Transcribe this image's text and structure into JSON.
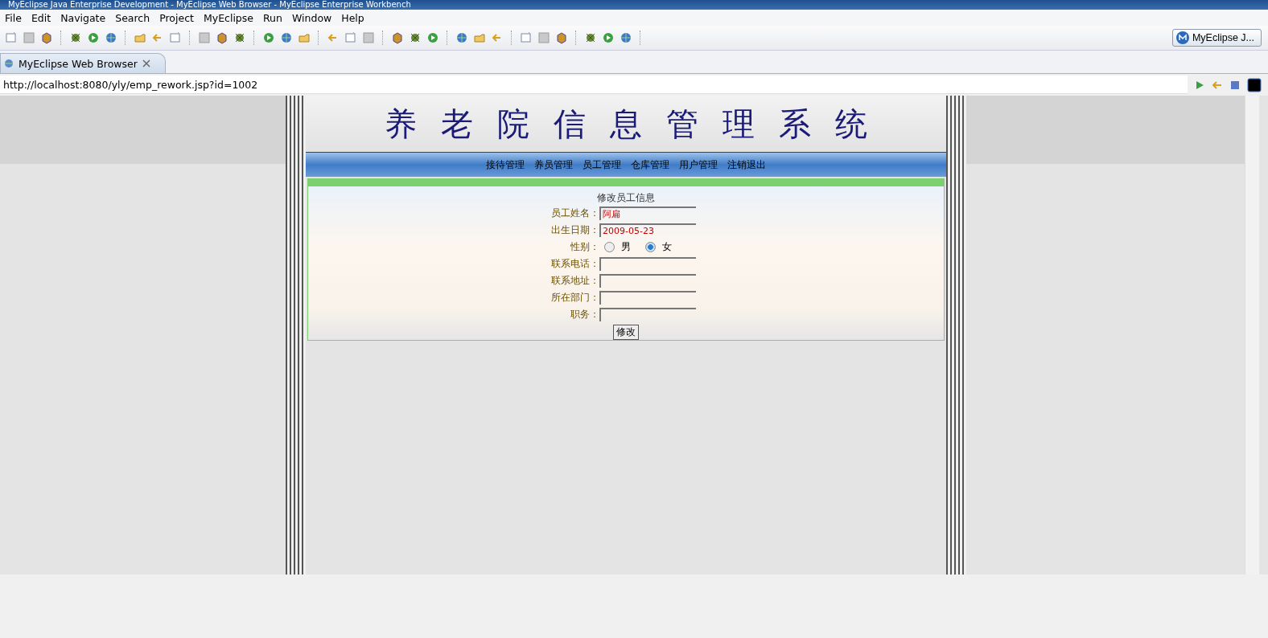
{
  "window": {
    "title": "MyEclipse Java Enterprise Development - MyEclipse Web Browser - MyEclipse Enterprise Workbench"
  },
  "menu": [
    "File",
    "Edit",
    "Navigate",
    "Search",
    "Project",
    "MyEclipse",
    "Run",
    "Window",
    "Help"
  ],
  "perspective": {
    "label": "MyEclipse J..."
  },
  "tabs": [
    {
      "label": "MyEclipse Web Browser",
      "selected": true
    }
  ],
  "browser": {
    "url": "http://localhost:8080/yly/emp_rework.jsp?id=1002"
  },
  "page": {
    "title": "养老院信息管理系统",
    "nav": [
      "接待管理",
      "养员管理",
      "员工管理",
      "仓库管理",
      "用户管理",
      "注销退出"
    ],
    "form": {
      "heading": "修改员工信息",
      "fields": [
        {
          "kind": "text",
          "label": "员工姓名：",
          "value": "阿扁"
        },
        {
          "kind": "text",
          "label": "出生日期：",
          "value": "2009-05-23"
        },
        {
          "kind": "radio",
          "label": "性别：",
          "options": [
            {
              "label": "男",
              "selected": false
            },
            {
              "label": "女",
              "selected": true
            }
          ]
        },
        {
          "kind": "text",
          "label": "联系电话："
        },
        {
          "kind": "text",
          "label": "联系地址："
        },
        {
          "kind": "text",
          "label": "所在部门："
        },
        {
          "kind": "text",
          "label": "职务："
        }
      ],
      "submit": "修改"
    }
  }
}
